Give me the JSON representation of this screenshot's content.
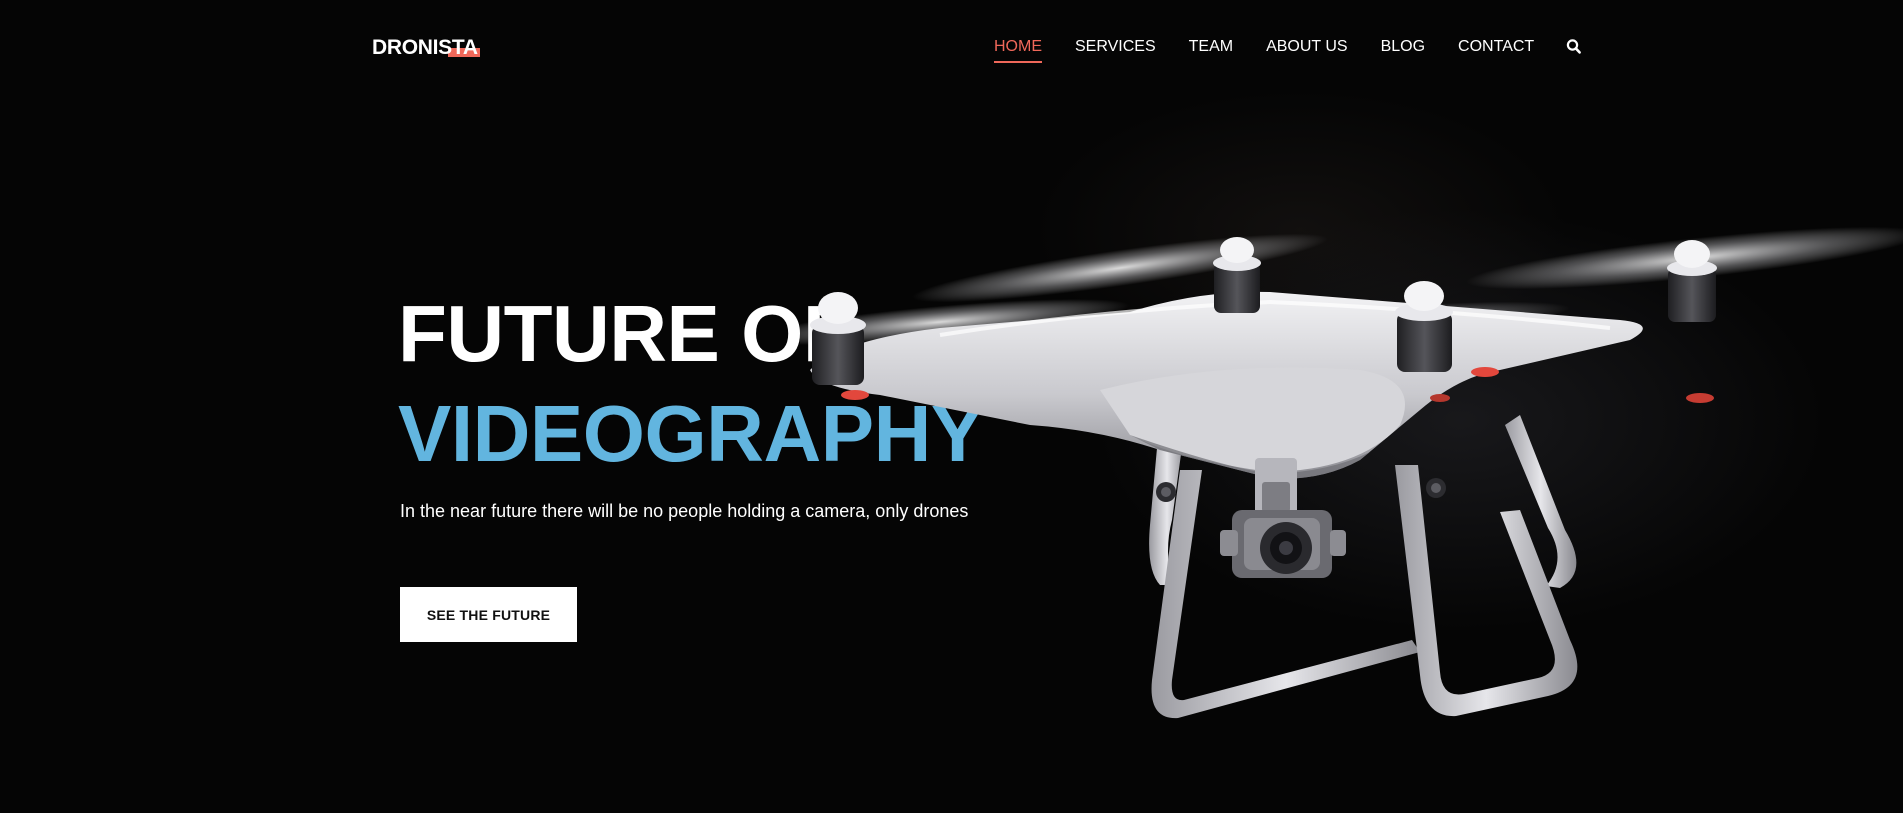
{
  "brand": {
    "name": "DRONISTA",
    "accent_color": "#f0685a"
  },
  "nav": {
    "items": [
      {
        "label": "HOME",
        "active": true
      },
      {
        "label": "SERVICES",
        "active": false
      },
      {
        "label": "TEAM",
        "active": false
      },
      {
        "label": "ABOUT US",
        "active": false
      },
      {
        "label": "BLOG",
        "active": false
      },
      {
        "label": "CONTACT",
        "active": false
      }
    ],
    "search_icon": "search-icon"
  },
  "hero": {
    "headline_line1": "FUTURE OF",
    "headline_line2": "VIDEOGRAPHY",
    "highlight_color": "#62b5df",
    "subtitle": "In the near future there will be no people holding a camera, only drones",
    "cta_label": "SEE THE FUTURE",
    "image": "drone-image"
  }
}
